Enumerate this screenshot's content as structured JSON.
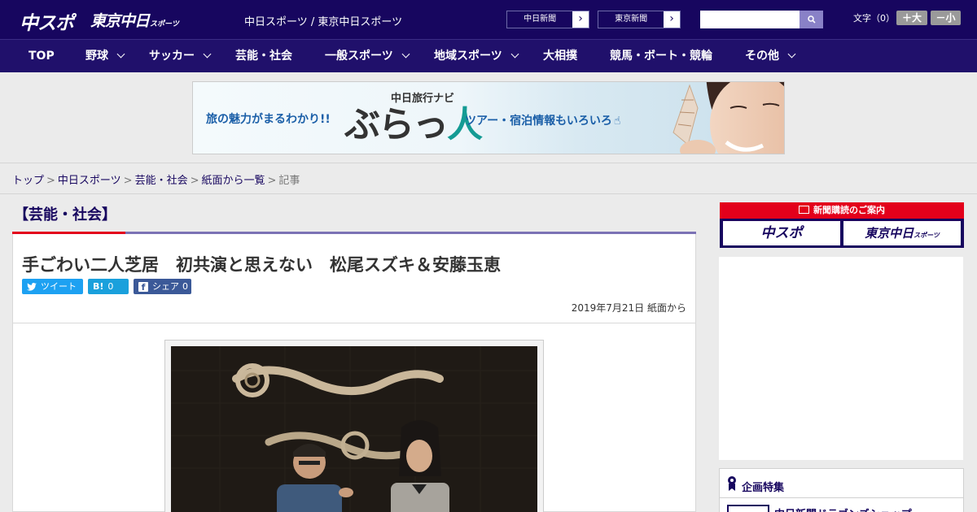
{
  "header": {
    "logo_main": "中スポ",
    "logo_tokyo": "東京中日",
    "logo_tokyo_small": "スポーツ",
    "sites": "中日スポーツ / 東京中日スポーツ",
    "link_chunichi": "中日新聞",
    "link_tokyo": "東京新聞",
    "search_placeholder": "",
    "font_label": "文字（0）",
    "font_plus": "＋大",
    "font_minus": "－小",
    "colors": {
      "header_bg": "#17065f",
      "nav_bg": "#20106b",
      "accent_red": "#e3001b"
    }
  },
  "nav": {
    "items": [
      {
        "label": "TOP",
        "dropdown": false
      },
      {
        "label": "野球",
        "dropdown": true
      },
      {
        "label": "サッカー",
        "dropdown": true
      },
      {
        "label": "芸能・社会",
        "dropdown": false
      },
      {
        "label": "一般スポーツ",
        "dropdown": true
      },
      {
        "label": "地域スポーツ",
        "dropdown": true
      },
      {
        "label": "大相撲",
        "dropdown": false
      },
      {
        "label": "競馬・ボート・競輪",
        "dropdown": false
      },
      {
        "label": "その他",
        "dropdown": true
      }
    ]
  },
  "ad_banner": {
    "left_text": "旅の魅力がまるわかり!!",
    "brand_top": "中日旅行ナビ",
    "brand_a": "ぶらっ",
    "brand_b": "人",
    "right_text": "ツアー・宿泊情報もいろいろ"
  },
  "breadcrumb": {
    "items": [
      "トップ",
      "中日スポーツ",
      "芸能・社会",
      "紙面から一覧"
    ],
    "current": "記事"
  },
  "article": {
    "section": "【芸能・社会】",
    "title": "手ごわい二人芝居　初共演と思えない　松尾スズキ＆安藤玉恵",
    "share_tweet": "ツイート",
    "share_hatena_icon": "B!",
    "share_hatena_count": "0",
    "share_facebook": "シェア",
    "share_facebook_count": "0",
    "date": "2019年7月21日 紙面から"
  },
  "sidebar": {
    "subscribe_head": "新聞購読のご案内",
    "subscribe_chuspo": "中スポ",
    "subscribe_tokyo": "東京中日",
    "subscribe_tokyo_small": "スポーツ",
    "feature_title": "企画特集",
    "feature_item": "中日新聞ドラゴンズショップ"
  }
}
